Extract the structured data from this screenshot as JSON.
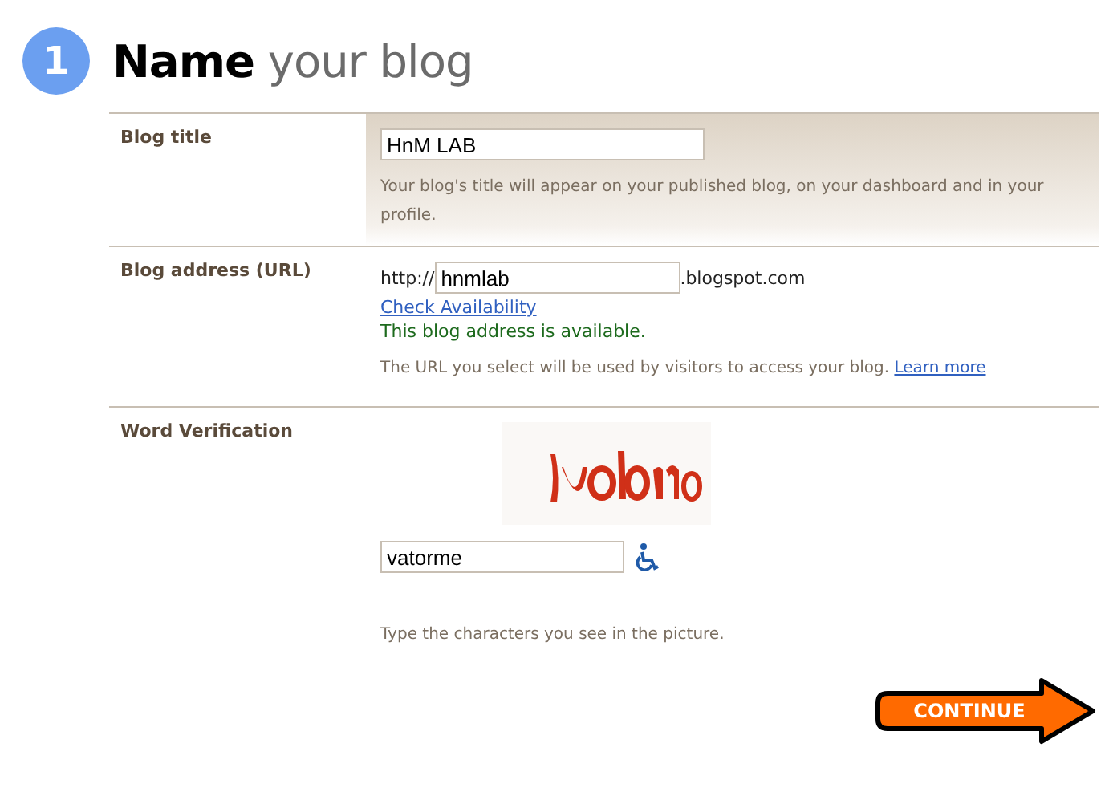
{
  "step": {
    "number": "1",
    "title": "**Name** your blog"
  },
  "fields": [
    {
      "kind": "title",
      "label": "Blog title",
      "value": "HnM LAB",
      "hint": "Your blog's title will appear on your published blog, on your dashboard and in your profile."
    },
    {
      "kind": "address",
      "label": "Blog address (URL)",
      "prefix": "http://",
      "value": "hnmlab",
      "suffix": ".blogspot.com",
      "link": "Check Availability",
      "status": "This blog address is available.",
      "hint": "The URL you select will be used by visitors to access your blog.",
      "hint_link": "Learn more"
    },
    {
      "kind": "captcha",
      "label": "Word Verification",
      "value": "vatorme",
      "hint": "Type the characters you see in the picture."
    }
  ],
  "continue_button": "CONTINUE"
}
